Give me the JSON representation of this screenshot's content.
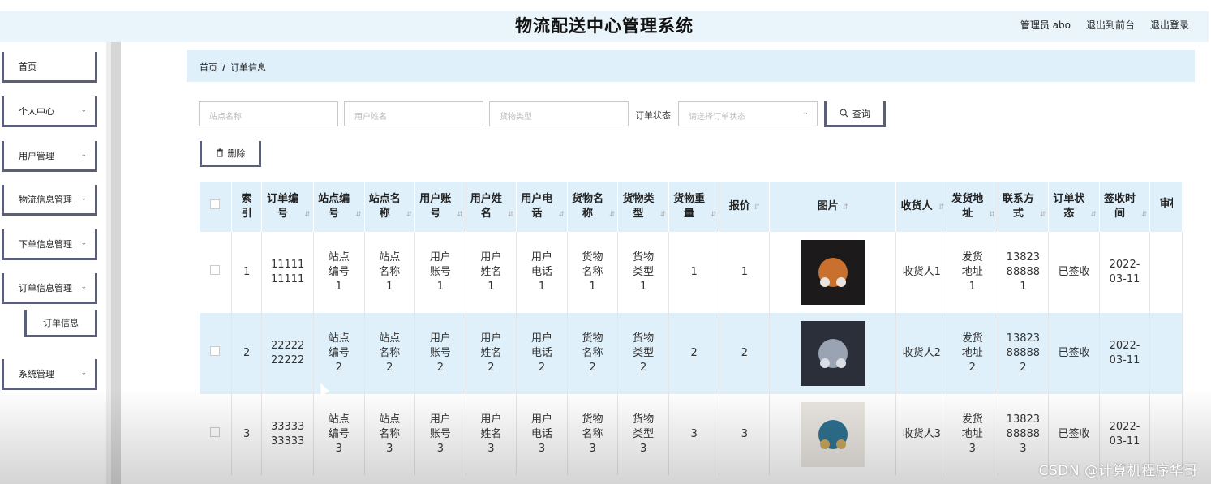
{
  "header": {
    "title": "物流配送中心管理系统",
    "user_label": "管理员 abo",
    "front_link": "退出到前台",
    "logout_link": "退出登录"
  },
  "sidebar": {
    "items": [
      {
        "label": "首页",
        "has_chevron": false
      },
      {
        "label": "个人中心",
        "has_chevron": true
      },
      {
        "label": "用户管理",
        "has_chevron": true
      },
      {
        "label": "物流信息管理",
        "has_chevron": true
      },
      {
        "label": "下单信息管理",
        "has_chevron": true
      },
      {
        "label": "订单信息管理",
        "has_chevron": true
      },
      {
        "label": "系统管理",
        "has_chevron": true
      }
    ],
    "subitem": "订单信息"
  },
  "breadcrumb": {
    "home": "首页",
    "sep": "/",
    "current": "订单信息"
  },
  "search": {
    "station_placeholder": "站点名称",
    "username_placeholder": "用户姓名",
    "cargo_type_placeholder": "货物类型",
    "status_label": "订单状态",
    "status_placeholder": "请选择订单状态",
    "query_button": "查询"
  },
  "toolbar": {
    "delete_button": "删除"
  },
  "table": {
    "headers": [
      "索引",
      "订单编号",
      "站点编号",
      "站点名称",
      "用户账号",
      "用户姓名",
      "用户电话",
      "货物名称",
      "货物类型",
      "货物重量",
      "报价",
      "图片",
      "收货人",
      "发货地址",
      "联系方式",
      "订单状态",
      "签收时间",
      "审核回复"
    ],
    "rows": [
      {
        "index": "1",
        "order_no": "1111111111",
        "station_no": "站点编号1",
        "station_name": "站点名称1",
        "account": "用户账号1",
        "name": "用户姓名1",
        "phone": "用户电话1",
        "cargo_name": "货物名称1",
        "cargo_type": "货物类型1",
        "weight": "1",
        "price": "1",
        "picture": "jewelry-photo-1",
        "receiver": "收货人1",
        "address": "发货地址1",
        "contact": "13823888881",
        "status": "已签收",
        "sign_time": "2022-03-11"
      },
      {
        "index": "2",
        "order_no": "2222222222",
        "station_no": "站点编号2",
        "station_name": "站点名称2",
        "account": "用户账号2",
        "name": "用户姓名2",
        "phone": "用户电话2",
        "cargo_name": "货物名称2",
        "cargo_type": "货物类型2",
        "weight": "2",
        "price": "2",
        "picture": "jewelry-photo-2",
        "receiver": "收货人2",
        "address": "发货地址2",
        "contact": "13823888882",
        "status": "已签收",
        "sign_time": "2022-03-11"
      },
      {
        "index": "3",
        "order_no": "3333333333",
        "station_no": "站点编号3",
        "station_name": "站点名称3",
        "account": "用户账号3",
        "name": "用户姓名3",
        "phone": "用户电话3",
        "cargo_name": "货物名称3",
        "cargo_type": "货物类型3",
        "weight": "3",
        "price": "3",
        "picture": "jewelry-photo-3",
        "receiver": "收货人3",
        "address": "发货地址3",
        "contact": "13823888883",
        "status": "已签收",
        "sign_time": "2022-03-11"
      }
    ]
  },
  "watermark": "CSDN @计算机程序华哥",
  "colors": {
    "accent_border": "#5b5f7a",
    "header_bg": "#eaf4fb",
    "row_highlight": "#dff0fa"
  }
}
